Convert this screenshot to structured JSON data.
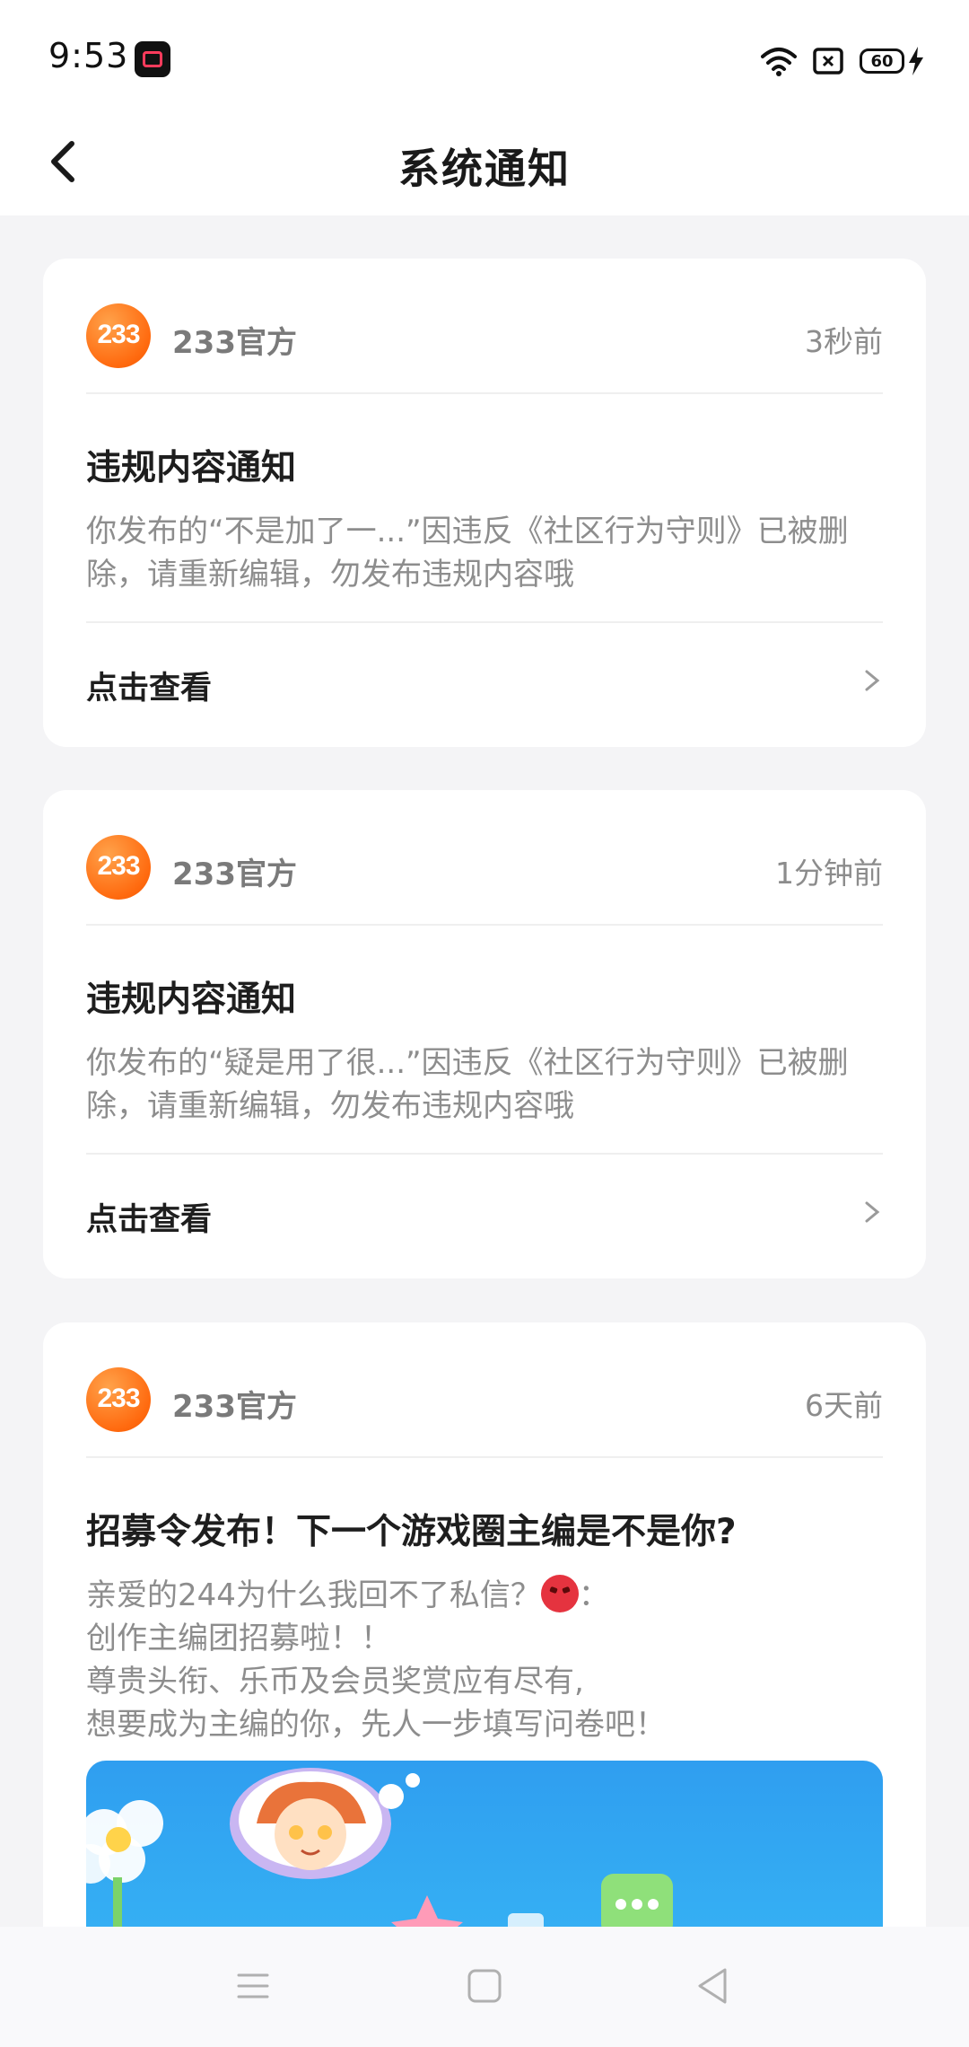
{
  "status": {
    "time": "9:53",
    "battery": "60"
  },
  "header": {
    "title": "系统通知"
  },
  "notifications": [
    {
      "logo_text": "233",
      "sender": "233官方",
      "time": "3秒前",
      "title": "违规内容通知",
      "body": "你发布的“不是加了一...”因违反《社区行为守则》已被删除，请重新编辑，勿发布违规内容哦",
      "action": "点击查看"
    },
    {
      "logo_text": "233",
      "sender": "233官方",
      "time": "1分钟前",
      "title": "违规内容通知",
      "body": "你发布的“疑是用了很...”因违反《社区行为守则》已被删除，请重新编辑，勿发布违规内容哦",
      "action": "点击查看"
    },
    {
      "logo_text": "233",
      "sender": "233官方",
      "time": "6天前",
      "title": "招募令发布！下一个游戏圈主编是不是你?",
      "body_lines": [
        "亲爱的244为什么我回不了私信？",
        "：",
        "创作主编团招募啦！！",
        "尊贵头衔、乐币及会员奖赏应有尽有,",
        "想要成为主编的你，先人一步填写问卷吧！"
      ]
    }
  ],
  "colors": {
    "brand_orange": "#ff6a0f",
    "banner_blue": "#36b2f4"
  }
}
